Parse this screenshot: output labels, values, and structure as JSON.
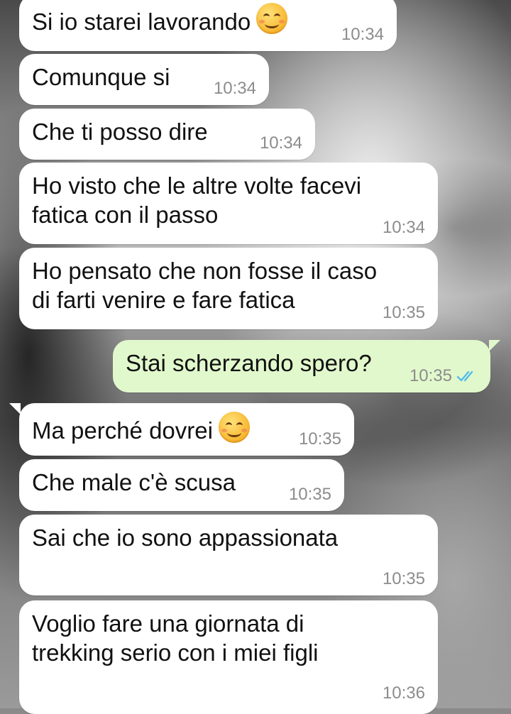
{
  "chat": {
    "messages": [
      {
        "direction": "incoming",
        "text": "Si io starei lavorando",
        "emoji": "smiling-face-icon",
        "time": "10:34"
      },
      {
        "direction": "incoming",
        "text": "Comunque si",
        "time": "10:34"
      },
      {
        "direction": "incoming",
        "text": "Che ti posso dire",
        "time": "10:34"
      },
      {
        "direction": "incoming",
        "text": "Ho visto che le altre volte facevi\nfatica con il passo",
        "time": "10:34"
      },
      {
        "direction": "incoming",
        "text": "Ho pensato che non fosse il caso\ndi farti venire e fare fatica",
        "time": "10:35"
      },
      {
        "direction": "outgoing",
        "text": "Stai scherzando spero?",
        "time": "10:35",
        "status": "double-check-icon",
        "status_color": "#53bdeb"
      },
      {
        "direction": "incoming",
        "text": "Ma perché dovrei",
        "emoji": "smiling-face-icon",
        "time": "10:35"
      },
      {
        "direction": "incoming",
        "text": "Che male c'è scusa",
        "time": "10:35"
      },
      {
        "direction": "incoming",
        "text": "Sai che io sono appassionata",
        "time": "10:35"
      },
      {
        "direction": "incoming",
        "text": "Voglio fare una giornata di\ntrekking serio con i miei figli",
        "time": "10:36"
      }
    ]
  },
  "colors": {
    "incoming_bubble": "#ffffff",
    "outgoing_bubble": "#e1f8cc",
    "timestamp": "#8c8c8c",
    "read_check": "#53bdeb"
  }
}
